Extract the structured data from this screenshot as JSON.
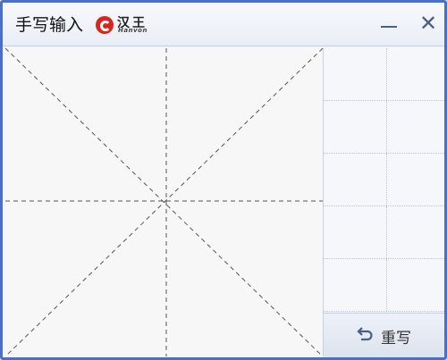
{
  "window": {
    "title": "手写输入",
    "logo_text": "汉王",
    "logo_subtext": "Hanvon"
  },
  "controls": {
    "minimize_icon": "minimize-icon",
    "close_icon": "close-icon",
    "close_glyph": "✕"
  },
  "rewrite": {
    "label": "重写",
    "icon": "undo-arrow-icon"
  },
  "colors": {
    "border": "#4a6fc9",
    "logo_red": "#d8251f",
    "guide_lines": "#555555"
  }
}
